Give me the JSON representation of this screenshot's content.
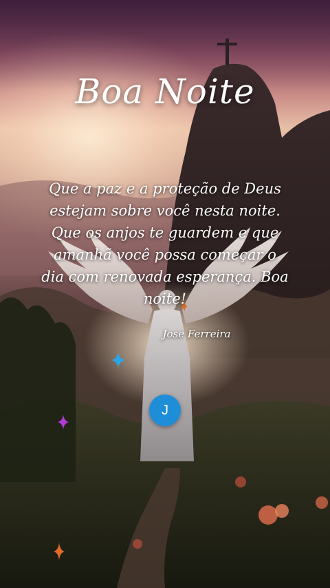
{
  "card": {
    "title": "Boa Noite",
    "message": "Que a paz e a proteção de Deus estejam sobre você nesta noite. Que os anjos te guardem e que amanhã você possa começar o dia com renovada esperança. Boa noite!",
    "author": "Jose Ferreira"
  },
  "avatar": {
    "initial": "J",
    "color": "#1f8ed8"
  },
  "sparkles": {
    "colors": [
      "#2aa7e8",
      "#b23ad6",
      "#e06a2a"
    ]
  }
}
